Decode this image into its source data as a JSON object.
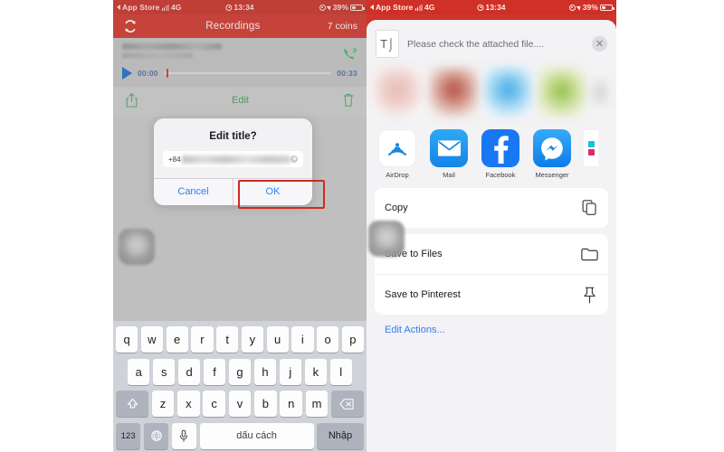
{
  "left_phone": {
    "status_bar": {
      "carrier_back": "App Store",
      "network": "4G",
      "time": "13:34",
      "battery": "39%",
      "battery_level": 39,
      "alarm_icon": "alarm-icon",
      "location_icon": "location-arrow-icon",
      "signal_icon": "signal-bars-icon"
    },
    "nav": {
      "refresh_icon": "refresh-icon",
      "title": "Recordings",
      "coins": "7 coins"
    },
    "recording": {
      "name_redacted": "",
      "sub_redacted": "",
      "phone_icon": "phone-call-icon",
      "time_start": "00:00",
      "time_end": "00:33",
      "play_icon": "play-icon",
      "progress_percent": 2
    },
    "action_bar": {
      "share_icon": "share-icon",
      "edit_label": "Edit",
      "delete_icon": "trash-icon"
    },
    "dialog": {
      "title": "Edit title?",
      "field_prefix": "+84",
      "field_value_redacted": "",
      "clear_icon": "clear-circle-icon",
      "cancel_label": "Cancel",
      "ok_label": "OK",
      "highlight_color": "#cf2a22",
      "highlighted_button": "OK"
    },
    "keyboard": {
      "row1": [
        "q",
        "w",
        "e",
        "r",
        "t",
        "y",
        "u",
        "i",
        "o",
        "p"
      ],
      "row2": [
        "a",
        "s",
        "d",
        "f",
        "g",
        "h",
        "j",
        "k",
        "l"
      ],
      "row3": [
        "z",
        "x",
        "c",
        "v",
        "b",
        "n",
        "m"
      ],
      "shift_icon": "shift-arrow-icon",
      "backspace_icon": "backspace-icon",
      "numbers_key": "123",
      "globe_icon": "globe-icon",
      "mic_icon": "microphone-icon",
      "space_label": "dấu cách",
      "return_label": "Nhập"
    },
    "touch_indicator": "touch-blob-icon"
  },
  "right_phone": {
    "status_bar": {
      "carrier_back": "App Store",
      "network": "4G",
      "time": "13:34",
      "battery": "39%",
      "battery_level": 39
    },
    "share_sheet": {
      "doc_icon": "text-document-icon",
      "subject": "Please check the attached file....",
      "close_icon": "close-icon",
      "thumbnails": [
        "blurred-thumb-1",
        "blurred-thumb-2",
        "blurred-thumb-3",
        "blurred-thumb-4",
        "blurred-thumb-5-partial"
      ],
      "apps": [
        {
          "name": "AirDrop",
          "icon": "airdrop-icon"
        },
        {
          "name": "Facebook",
          "icon": "facebook-icon"
        },
        {
          "name": "Mail",
          "icon": "mail-icon"
        },
        {
          "name": "Messenger",
          "icon": "messenger-icon"
        },
        {
          "name": "",
          "icon": "partial-app-icon"
        }
      ],
      "actions": [
        {
          "label": "Copy",
          "icon": "copy-icon"
        },
        {
          "label": "Save to Files",
          "icon": "folder-icon"
        },
        {
          "label": "Save to Pinterest",
          "icon": "pin-icon"
        }
      ],
      "edit_actions_label": "Edit Actions...",
      "touch_indicator": "touch-blob-icon"
    }
  }
}
